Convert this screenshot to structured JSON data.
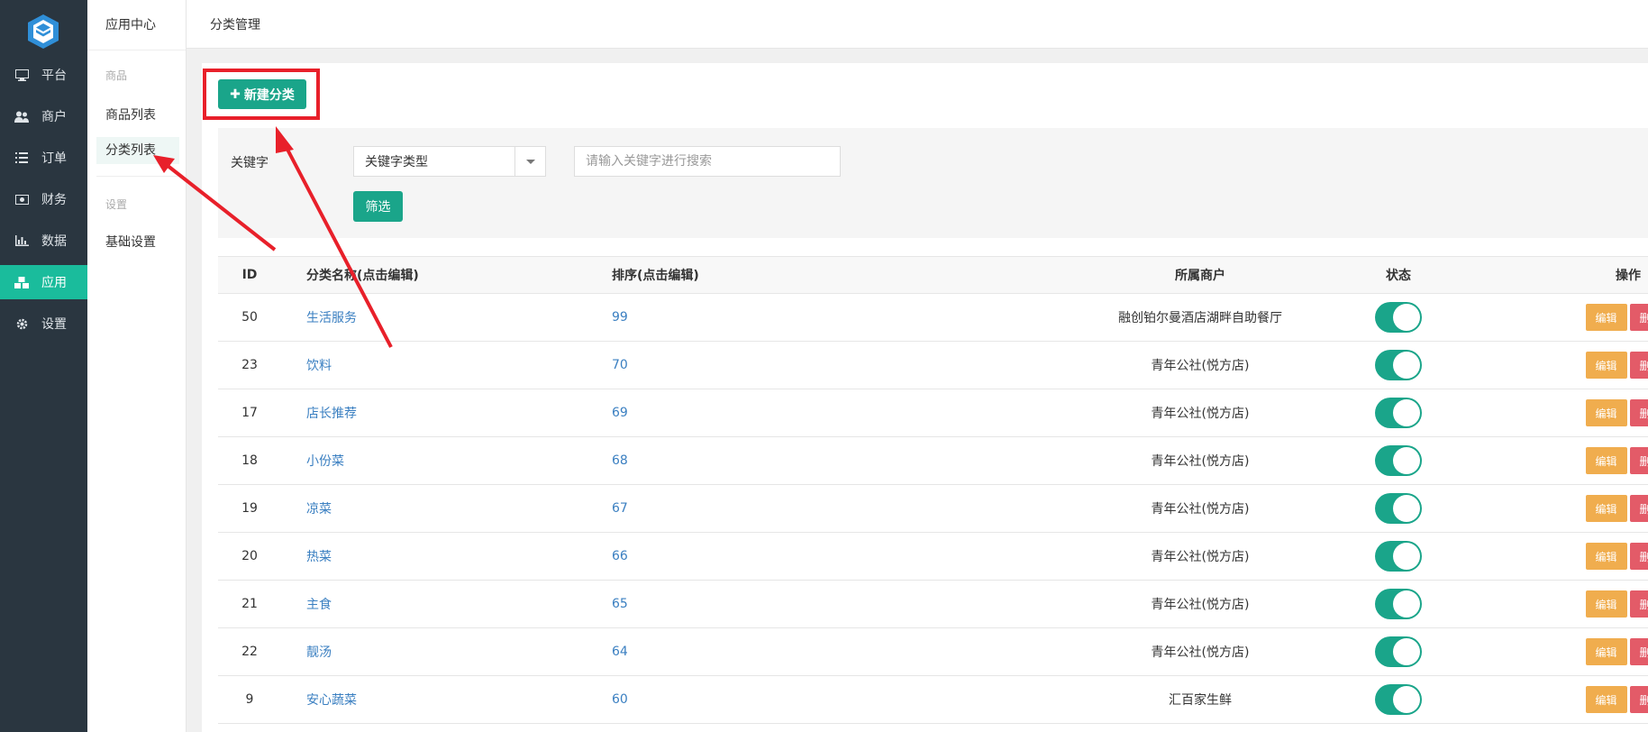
{
  "nav": {
    "items": [
      {
        "label": "平台",
        "icon": "monitor-icon"
      },
      {
        "label": "商户",
        "icon": "users-icon"
      },
      {
        "label": "订单",
        "icon": "list-icon"
      },
      {
        "label": "财务",
        "icon": "money-icon"
      },
      {
        "label": "数据",
        "icon": "bar-chart-icon"
      },
      {
        "label": "应用",
        "icon": "cubes-icon",
        "active": true
      },
      {
        "label": "设置",
        "icon": "gear-icon"
      }
    ],
    "active_color": "#1abc9c"
  },
  "subnav": {
    "header": "应用中心",
    "group_goods": "商品",
    "goods_list": "商品列表",
    "category_list": "分类列表",
    "group_settings": "设置",
    "basic_settings": "基础设置"
  },
  "topbar": {
    "title": "分类管理"
  },
  "toolbar": {
    "new_category_label": "新建分类"
  },
  "filter": {
    "keyword_label": "关键字",
    "keyword_type_selected": "关键字类型",
    "search_placeholder": "请输入关键字进行搜索",
    "filter_button": "筛选"
  },
  "table": {
    "headers": {
      "id": "ID",
      "name": "分类名称(点击编辑)",
      "sort": "排序(点击编辑)",
      "shop": "所属商户",
      "status": "状态",
      "actions": "操作"
    },
    "edit_label": "编辑",
    "delete_label": "删除",
    "rows": [
      {
        "id": "50",
        "name": "生活服务",
        "sort": "99",
        "shop": "融创铂尔曼酒店湖畔自助餐厅",
        "enabled": true
      },
      {
        "id": "23",
        "name": "饮料",
        "sort": "70",
        "shop": "青年公社(悦方店)",
        "enabled": true
      },
      {
        "id": "17",
        "name": "店长推荐",
        "sort": "69",
        "shop": "青年公社(悦方店)",
        "enabled": true
      },
      {
        "id": "18",
        "name": "小份菜",
        "sort": "68",
        "shop": "青年公社(悦方店)",
        "enabled": true
      },
      {
        "id": "19",
        "name": "凉菜",
        "sort": "67",
        "shop": "青年公社(悦方店)",
        "enabled": true
      },
      {
        "id": "20",
        "name": "热菜",
        "sort": "66",
        "shop": "青年公社(悦方店)",
        "enabled": true
      },
      {
        "id": "21",
        "name": "主食",
        "sort": "65",
        "shop": "青年公社(悦方店)",
        "enabled": true
      },
      {
        "id": "22",
        "name": "靓汤",
        "sort": "64",
        "shop": "青年公社(悦方店)",
        "enabled": true
      },
      {
        "id": "9",
        "name": "安心蔬菜",
        "sort": "60",
        "shop": "汇百家生鲜",
        "enabled": true
      }
    ]
  },
  "colors": {
    "primary": "#1aa58a",
    "edit": "#f0ad4e",
    "delete": "#e35b68",
    "annotation": "#e8202a",
    "link": "#3a7fc1"
  }
}
